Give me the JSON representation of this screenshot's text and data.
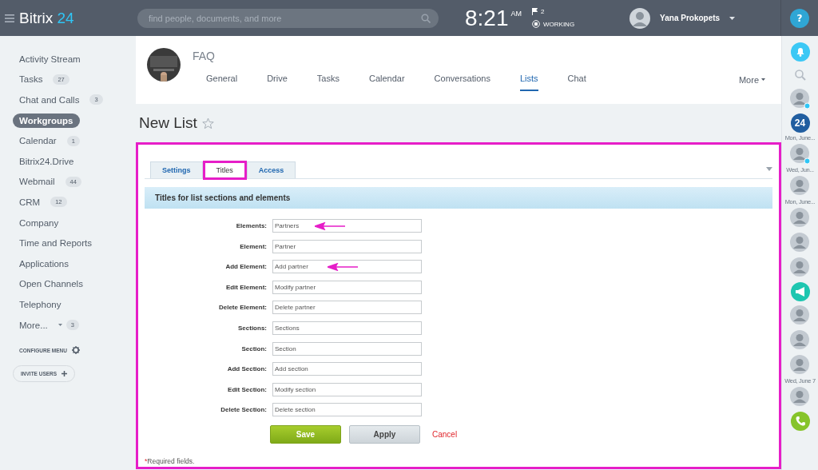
{
  "header": {
    "logo": {
      "name": "Bitrix",
      "number": "24"
    },
    "search": {
      "placeholder": "find people, documents, and more"
    },
    "clock": {
      "time": "8:21",
      "period": "AM"
    },
    "flags": "2",
    "work_status": "WORKING",
    "user": {
      "name": "Yana Prokopets"
    },
    "help": "?"
  },
  "sidebar": {
    "items": [
      {
        "label": "Activity Stream",
        "selected": false
      },
      {
        "label": "Tasks",
        "count": "27",
        "selected": false
      },
      {
        "label": "Chat and Calls",
        "count": "3",
        "selected": false
      },
      {
        "label": "Workgroups",
        "selected": true
      },
      {
        "label": "Calendar",
        "count": "1",
        "selected": false
      },
      {
        "label": "Bitrix24.Drive",
        "selected": false
      },
      {
        "label": "Webmail",
        "count": "44",
        "selected": false
      },
      {
        "label": "CRM",
        "count": "12",
        "selected": false
      },
      {
        "label": "Company",
        "selected": false
      },
      {
        "label": "Time and Reports",
        "selected": false
      },
      {
        "label": "Applications",
        "selected": false
      },
      {
        "label": "Open Channels",
        "selected": false
      },
      {
        "label": "Telephony",
        "selected": false
      },
      {
        "label": "More...",
        "count": "3",
        "selected": false,
        "dropdown": true
      }
    ],
    "configure": "CONFIGURE MENU",
    "invite": "INVITE USERS"
  },
  "group": {
    "title": "FAQ",
    "nav": [
      {
        "label": "General",
        "selected": false
      },
      {
        "label": "Drive",
        "selected": false
      },
      {
        "label": "Tasks",
        "selected": false
      },
      {
        "label": "Calendar",
        "selected": false
      },
      {
        "label": "Conversations",
        "selected": false
      },
      {
        "label": "Lists",
        "selected": true
      },
      {
        "label": "Chat",
        "selected": false
      }
    ],
    "more": "More"
  },
  "page_title": "New List",
  "form": {
    "highlighted": true,
    "tabs": [
      {
        "label": "Settings",
        "selected": false,
        "highlighted": false
      },
      {
        "label": "Titles",
        "selected": true,
        "highlighted": true
      },
      {
        "label": "Access",
        "selected": false,
        "highlighted": false
      }
    ],
    "section_title": "Titles for list sections and elements",
    "fields": [
      {
        "label": "Elements:",
        "value": "Partners",
        "arrow": true
      },
      {
        "label": "Element:",
        "value": "Partner",
        "arrow": false
      },
      {
        "label": "Add Element:",
        "value": "Add partner",
        "arrow": true
      },
      {
        "label": "Edit Element:",
        "value": "Modify partner",
        "arrow": false
      },
      {
        "label": "Delete Element:",
        "value": "Delete partner",
        "arrow": false
      },
      {
        "label": "Sections:",
        "value": "Sections",
        "arrow": false
      },
      {
        "label": "Section:",
        "value": "Section",
        "arrow": false
      },
      {
        "label": "Add Section:",
        "value": "Add section",
        "arrow": false
      },
      {
        "label": "Edit Section:",
        "value": "Modify section",
        "arrow": false
      },
      {
        "label": "Delete Section:",
        "value": "Delete section",
        "arrow": false
      }
    ],
    "buttons": [
      {
        "label": "Save",
        "kind": "primary"
      },
      {
        "label": "Apply",
        "kind": "secondary"
      },
      {
        "label": "Cancel",
        "kind": "link"
      }
    ],
    "required_mark": "*",
    "required_note": "Required fields."
  },
  "rail": [
    {
      "kind": "bell"
    },
    {
      "kind": "search"
    },
    {
      "kind": "avatar",
      "online": true
    },
    {
      "kind": "logo",
      "text": "24"
    },
    {
      "kind": "date",
      "text": "Mon, June..."
    },
    {
      "kind": "avatar",
      "online": true
    },
    {
      "kind": "date",
      "text": "Wed, Jun..."
    },
    {
      "kind": "avatar",
      "online": false
    },
    {
      "kind": "date",
      "text": "Mon, June..."
    },
    {
      "kind": "avatar",
      "online": false
    },
    {
      "kind": "avatar",
      "online": false
    },
    {
      "kind": "avatar",
      "online": false
    },
    {
      "kind": "megaphone"
    },
    {
      "kind": "avatar",
      "online": false
    },
    {
      "kind": "avatar",
      "online": false
    },
    {
      "kind": "avatar",
      "online": false
    },
    {
      "kind": "date",
      "text": "Wed, June 7"
    },
    {
      "kind": "avatar",
      "online": false
    },
    {
      "kind": "phone"
    }
  ]
}
